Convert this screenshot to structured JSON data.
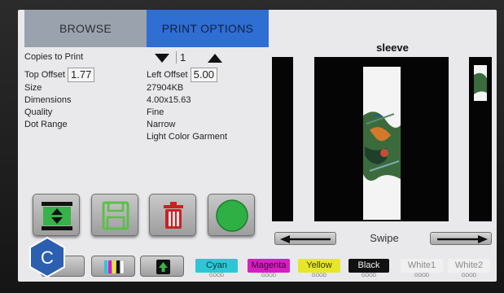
{
  "tabs": {
    "browse": "BROWSE",
    "print_options": "PRINT OPTIONS"
  },
  "info": {
    "copies_label": "Copies to Print",
    "copies_value": "1",
    "top_offset_label": "Top Offset",
    "top_offset_value": "1.77",
    "left_offset_label": "Left Offset",
    "left_offset_value": "5.00",
    "size_label": "Size",
    "size_value": "27904KB",
    "dimensions_label": "Dimensions",
    "dimensions_value": "4.00x15.63",
    "quality_label": "Quality",
    "quality_value": "Fine",
    "dot_range_label": "Dot Range",
    "dot_range_value": "Narrow",
    "garment_value": "Light Color Garment"
  },
  "preview": {
    "title": "sleeve",
    "swipe_label": "Swipe"
  },
  "inks": [
    {
      "name": "Cyan",
      "status": "GOOD",
      "color": "#2ec6d6",
      "text": "#0b3a40"
    },
    {
      "name": "Magenta",
      "status": "GOOD",
      "color": "#d61fc1",
      "text": "#3a0634"
    },
    {
      "name": "Yellow",
      "status": "GOOD",
      "color": "#e7e62a",
      "text": "#3a3a05"
    },
    {
      "name": "Black",
      "status": "GOOD",
      "color": "#111111",
      "text": "#f2f2f2"
    },
    {
      "name": "White1",
      "status": "GOOD",
      "color": "#f0f0f0",
      "text": "#8a8a8a"
    },
    {
      "name": "White2",
      "status": "GOOD",
      "color": "#f0f0f0",
      "text": "#8a8a8a"
    }
  ],
  "badge": {
    "letter": "C",
    "color": "#2c5fb0"
  }
}
